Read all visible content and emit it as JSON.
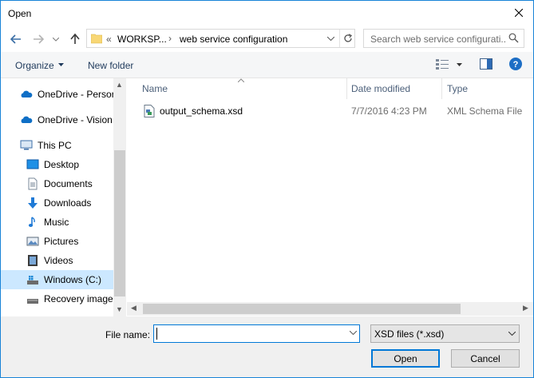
{
  "window": {
    "title": "Open"
  },
  "address": {
    "overflow": "«",
    "crumbs": [
      "WORKSP...",
      "web service configuration"
    ]
  },
  "search": {
    "placeholder": "Search web service configurati..."
  },
  "toolbar": {
    "organize": "Organize",
    "new_folder": "New folder"
  },
  "sidebar": {
    "items": [
      {
        "label": "OneDrive - Persor",
        "icon": "onedrive-icon"
      },
      {
        "label": "OneDrive - Vision",
        "icon": "onedrive-icon"
      },
      {
        "label": "This PC",
        "icon": "computer-icon"
      },
      {
        "label": "Desktop",
        "icon": "desktop-icon"
      },
      {
        "label": "Documents",
        "icon": "documents-icon"
      },
      {
        "label": "Downloads",
        "icon": "downloads-icon"
      },
      {
        "label": "Music",
        "icon": "music-icon"
      },
      {
        "label": "Pictures",
        "icon": "pictures-icon"
      },
      {
        "label": "Videos",
        "icon": "videos-icon"
      },
      {
        "label": "Windows (C:)",
        "icon": "drive-icon",
        "selected": true
      },
      {
        "label": "Recovery image",
        "icon": "drive-icon"
      }
    ]
  },
  "columns": {
    "name": "Name",
    "date": "Date modified",
    "type": "Type"
  },
  "files": [
    {
      "name": "output_schema.xsd",
      "date": "7/7/2016 4:23 PM",
      "type": "XML Schema File"
    }
  ],
  "footer": {
    "file_name_label": "File name:",
    "file_name_value": "",
    "filter": "XSD files (*.xsd)",
    "open": "Open",
    "cancel": "Cancel"
  },
  "colors": {
    "accent": "#0078d7",
    "selection": "#cce8ff",
    "help": "#1d6ec5"
  }
}
